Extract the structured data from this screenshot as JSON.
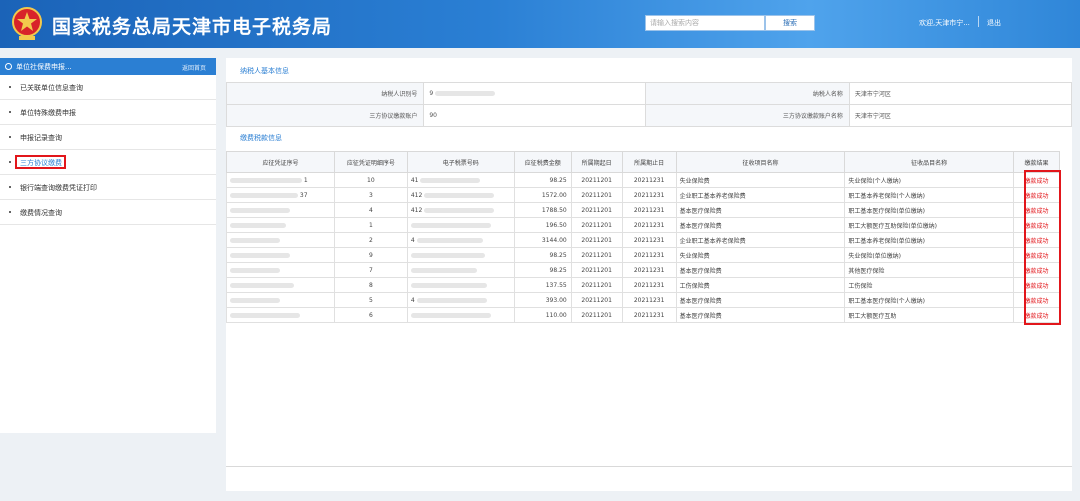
{
  "header": {
    "title": "国家税务总局天津市电子税务局",
    "search_placeholder": "请输入搜索内容",
    "search_button": "搜索",
    "welcome": "欢迎,天津市宁...",
    "logout": "退出",
    "brand_color": "#2a7fd4"
  },
  "sidebar": {
    "header": "单位社保费申报...",
    "back_home": "返回首页",
    "items": [
      {
        "label": "已关联单位信息查询"
      },
      {
        "label": "单位特殊缴费申报"
      },
      {
        "label": "申报记录查询"
      },
      {
        "label": "三方协议缴费"
      },
      {
        "label": "银行端查询缴费凭证打印"
      },
      {
        "label": "缴费情况查询"
      }
    ]
  },
  "taxpayer": {
    "section_title": "纳税人基本信息",
    "id_label": "纳税人识别号",
    "id_value": "9",
    "name_label": "纳税人名称",
    "name_value": "天津市宁河区",
    "account_label": "三方协议缴款账户",
    "account_value": "90",
    "account_name_label": "三方协议缴款账户名称",
    "account_name_value": "天津市宁河区"
  },
  "payment": {
    "section_title": "缴费税款信息",
    "columns": [
      "应征凭证序号",
      "应征凭证明细序号",
      "电子税票号码",
      "应征税费金额",
      "所属期起日",
      "所属期止日",
      "征收项目名称",
      "征收品目名称",
      "缴款结果"
    ],
    "rows": [
      {
        "seq": "1",
        "detail": "10",
        "ticket": "41",
        "amount": "98.25",
        "start": "20211201",
        "end": "20211231",
        "item": "失业保险费",
        "sub": "失业保险(个人缴纳)",
        "result": "缴款成功"
      },
      {
        "seq": "37",
        "detail": "3",
        "ticket": "412",
        "amount": "1572.00",
        "start": "20211201",
        "end": "20211231",
        "item": "企业职工基本养老保险费",
        "sub": "职工基本养老保险(个人缴纳)",
        "result": "缴款成功"
      },
      {
        "seq": "",
        "detail": "4",
        "ticket": "412",
        "amount": "1788.50",
        "start": "20211201",
        "end": "20211231",
        "item": "基本医疗保险费",
        "sub": "职工基本医疗保险(单位缴纳)",
        "result": "缴款成功"
      },
      {
        "seq": "",
        "detail": "1",
        "ticket": "",
        "amount": "196.50",
        "start": "20211201",
        "end": "20211231",
        "item": "基本医疗保险费",
        "sub": "职工大额医疗互助保险(单位缴纳)",
        "result": "缴款成功"
      },
      {
        "seq": "",
        "detail": "2",
        "ticket": "4",
        "amount": "3144.00",
        "start": "20211201",
        "end": "20211231",
        "item": "企业职工基本养老保险费",
        "sub": "职工基本养老保险(单位缴纳)",
        "result": "缴款成功"
      },
      {
        "seq": "",
        "detail": "9",
        "ticket": "",
        "amount": "98.25",
        "start": "20211201",
        "end": "20211231",
        "item": "失业保险费",
        "sub": "失业保险(单位缴纳)",
        "result": "缴款成功"
      },
      {
        "seq": "",
        "detail": "7",
        "ticket": "",
        "amount": "98.25",
        "start": "20211201",
        "end": "20211231",
        "item": "基本医疗保险费",
        "sub": "其他医疗保险",
        "result": "缴款成功"
      },
      {
        "seq": "",
        "detail": "8",
        "ticket": "",
        "amount": "137.55",
        "start": "20211201",
        "end": "20211231",
        "item": "工伤保险费",
        "sub": "工伤保险",
        "result": "缴款成功"
      },
      {
        "seq": "",
        "detail": "5",
        "ticket": "4",
        "amount": "393.00",
        "start": "20211201",
        "end": "20211231",
        "item": "基本医疗保险费",
        "sub": "职工基本医疗保险(个人缴纳)",
        "result": "缴款成功"
      },
      {
        "seq": "",
        "detail": "6",
        "ticket": "",
        "amount": "110.00",
        "start": "20211201",
        "end": "20211231",
        "item": "基本医疗保险费",
        "sub": "职工大额医疗互助",
        "result": "缴款成功"
      }
    ]
  }
}
